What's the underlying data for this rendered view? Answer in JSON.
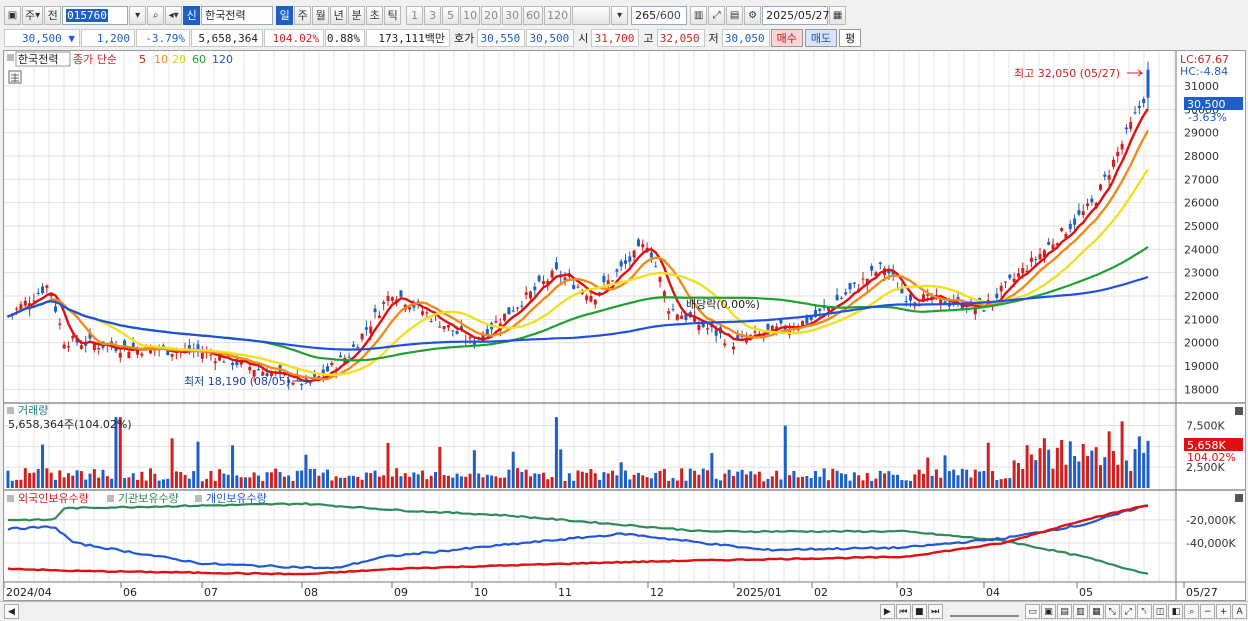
{
  "toolbar": {
    "period_type": "주",
    "prev_label": "전",
    "stock_code": "015760",
    "new_badge": "신",
    "stock_name": "한국전력",
    "periods": [
      "일",
      "주",
      "월",
      "년",
      "분",
      "초",
      "틱"
    ],
    "active_period": "일",
    "intervals": [
      "1",
      "3",
      "5",
      "10",
      "20",
      "30",
      "60",
      "120"
    ],
    "count": "265",
    "count_max": "/600",
    "date": "2025/05/27"
  },
  "quote": {
    "price": "30,500",
    "change": "1,200",
    "change_pct": "-3.79%",
    "volume": "5,658,364",
    "volume_ratio": "104.02%",
    "turnover": "0.88%",
    "amount": "173,111백만",
    "bid_label": "호가",
    "bid1": "30,550",
    "bid2": "30,500",
    "open_label": "시",
    "open": "31,700",
    "high_label": "고",
    "high": "32,050",
    "low_label": "저",
    "low": "30,050",
    "buy_label": "매수",
    "sell_label": "매도",
    "eval_label": "평"
  },
  "price_pane": {
    "stock_label": "한국전력",
    "ma_label": "종가 단순",
    "ma_periods": [
      "5",
      "10",
      "20",
      "60",
      "120"
    ],
    "lc": "LC:67.67",
    "hc": "HC:-4.84",
    "high_note": "최고 32,050 (05/27)",
    "low_note": "최저 18,190 (08/05)",
    "dividend_note": "배당락(0.00%)",
    "price_tag": "30,500",
    "pct_tag": "-3.63%"
  },
  "volume_pane": {
    "label": "거래량",
    "value_label": "5,658,364주(104.02%)",
    "tag": "5,658K",
    "tag_pct": "104.02%"
  },
  "holdings_pane": {
    "labels": [
      "외국인보유수량",
      "기관보유수량",
      "개인보유수량"
    ]
  },
  "x_axis": [
    "2024/04",
    "06",
    "07",
    "08",
    "09",
    "10",
    "11",
    "12",
    "2025/01",
    "02",
    "03",
    "04",
    "05",
    "05/27"
  ],
  "colors": {
    "up": "#d01f1f",
    "down": "#1d5fc7",
    "ma5": "#e01010",
    "ma10": "#f08a18",
    "ma20": "#f0e020",
    "ma60": "#20a030",
    "ma120": "#2050e0",
    "foreign": "#e01010",
    "institution": "#2e8b57",
    "individual": "#2258d8"
  },
  "chart_data": [
    {
      "type": "candlestick",
      "title": "한국전력",
      "ylim": [
        17500,
        32500
      ],
      "y_ticks": [
        18000,
        19000,
        20000,
        21000,
        22000,
        23000,
        24000,
        25000,
        26000,
        27000,
        28000,
        29000,
        30000,
        31000
      ],
      "x_labels": [
        "2024/04",
        "06",
        "07",
        "08",
        "09",
        "10",
        "11",
        "12",
        "2025/01",
        "02",
        "03",
        "04",
        "05"
      ],
      "close_keypoints": [
        {
          "date": "2024/04",
          "close": 21000
        },
        {
          "date": "2024/04 late",
          "close": 22500
        },
        {
          "date": "2024/05",
          "close": 20100
        },
        {
          "date": "2024/06",
          "close": 19800
        },
        {
          "date": "2024/07",
          "close": 19600
        },
        {
          "date": "2024/08/05",
          "close": 18190
        },
        {
          "date": "2024/08 late",
          "close": 19500
        },
        {
          "date": "2024/09",
          "close": 22200
        },
        {
          "date": "2024/10",
          "close": 20000
        },
        {
          "date": "2024/11",
          "close": 23000
        },
        {
          "date": "2024/11 late",
          "close": 22000
        },
        {
          "date": "2024/12",
          "close": 24300
        },
        {
          "date": "2024/12 mid",
          "close": 21500
        },
        {
          "date": "2025/01",
          "close": 20000
        },
        {
          "date": "2025/02",
          "close": 21000
        },
        {
          "date": "2025/03",
          "close": 23300
        },
        {
          "date": "2025/03 mid",
          "close": 22000
        },
        {
          "date": "2025/04",
          "close": 21500
        },
        {
          "date": "2025/05",
          "close": 26000
        },
        {
          "date": "2025/05/27",
          "close": 30500
        }
      ],
      "moving_averages": [
        {
          "name": "5",
          "end": 30300
        },
        {
          "name": "10",
          "end": 29000
        },
        {
          "name": "20",
          "end": 27500
        },
        {
          "name": "60",
          "end": 24300
        },
        {
          "name": "120",
          "end": 22700
        }
      ]
    },
    {
      "type": "bar",
      "title": "거래량",
      "y_ticks": [
        "2,500K",
        "5,000K",
        "7,500K"
      ],
      "last_value": 5658364
    },
    {
      "type": "line",
      "series": [
        {
          "name": "외국인보유수량",
          "start": -52000,
          "end": -8000
        },
        {
          "name": "기관보유수량",
          "start": -20000,
          "end": -68000
        },
        {
          "name": "개인보유수량",
          "start": -28000,
          "end": -8000
        }
      ],
      "y_ticks": [
        "-20,000K",
        "-40,000K"
      ]
    }
  ]
}
